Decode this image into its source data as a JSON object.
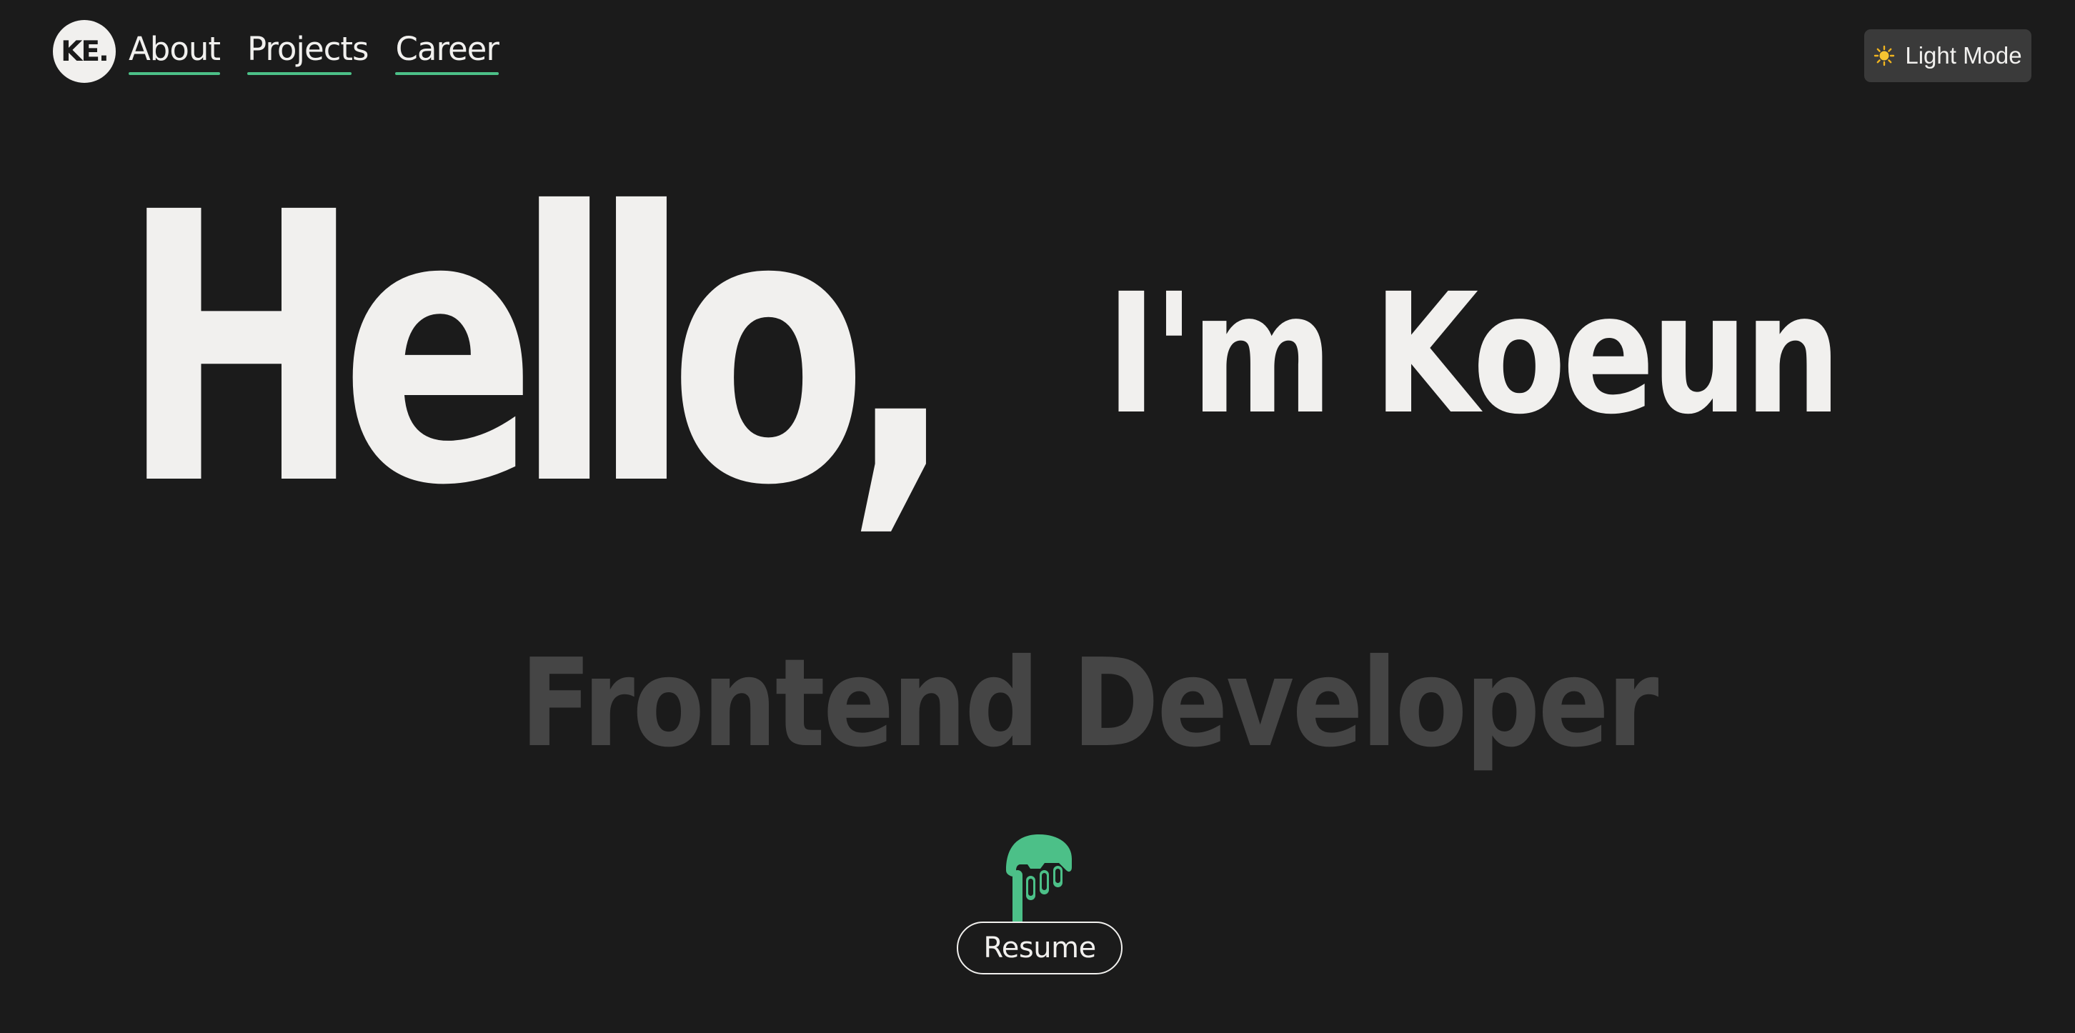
{
  "nav": {
    "logo_text": "KE.",
    "links": [
      {
        "label": "About"
      },
      {
        "label": "Projects"
      },
      {
        "label": "Career"
      }
    ]
  },
  "theme_toggle": {
    "icon": "sun-icon",
    "label": "Light Mode"
  },
  "hero": {
    "greeting": "Hello,",
    "intro": "I'm Koeun",
    "role": "Frontend Developer"
  },
  "resume": {
    "icon": "mascot-icon",
    "label": "Resume"
  },
  "colors": {
    "background": "#1b1b1b",
    "text": "#f1f0ee",
    "accent": "#4cc088",
    "muted": "#454545",
    "toggle_bg": "#3a3a3a"
  }
}
